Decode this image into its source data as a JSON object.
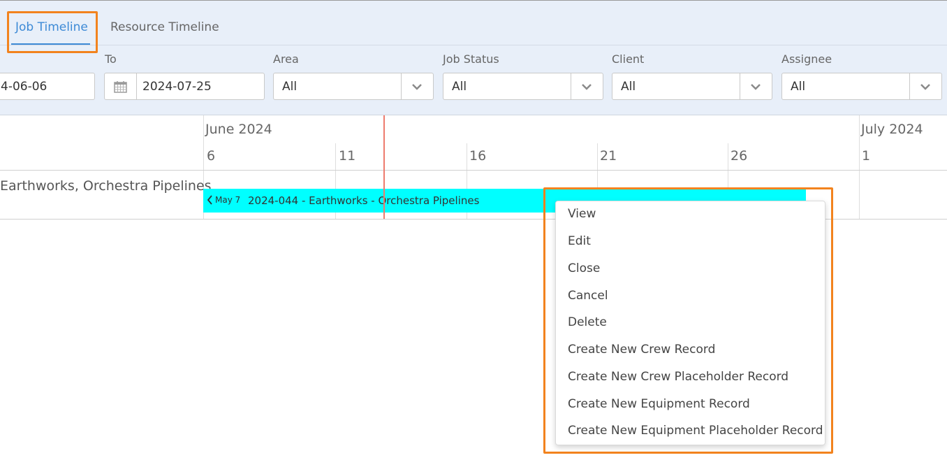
{
  "tabs": [
    {
      "label": "Job Timeline",
      "active": true
    },
    {
      "label": "Resource Timeline",
      "active": false
    }
  ],
  "filters": {
    "from": {
      "value": "4-06-06"
    },
    "to": {
      "label": "To",
      "value": "2024-07-25",
      "icon": "calendar-icon"
    },
    "area": {
      "label": "Area",
      "value": "All"
    },
    "job_status": {
      "label": "Job Status",
      "value": "All"
    },
    "client": {
      "label": "Client",
      "value": "All"
    },
    "assignee": {
      "label": "Assignee",
      "value": "All"
    }
  },
  "timeline": {
    "months": [
      "June 2024",
      "July 2024"
    ],
    "days": [
      "6",
      "11",
      "16",
      "21",
      "26",
      "1"
    ],
    "rows": [
      {
        "label": "Earthworks, Orchestra Pipelines",
        "bar": {
          "start_label": "May 7",
          "title": "2024-044 - Earthworks - Orchestra Pipelines",
          "color": "#00ffff"
        }
      }
    ]
  },
  "context_menu": {
    "items": [
      "View",
      "Edit",
      "Close",
      "Cancel",
      "Delete",
      "Create New Crew Record",
      "Create New Crew Placeholder Record",
      "Create New Equipment Record",
      "Create New Equipment Placeholder Record"
    ]
  },
  "colors": {
    "accent": "#3d8ad6",
    "highlight": "#f2831e",
    "today_line": "#ee7b6d",
    "panel_bg": "#e8eff9"
  }
}
